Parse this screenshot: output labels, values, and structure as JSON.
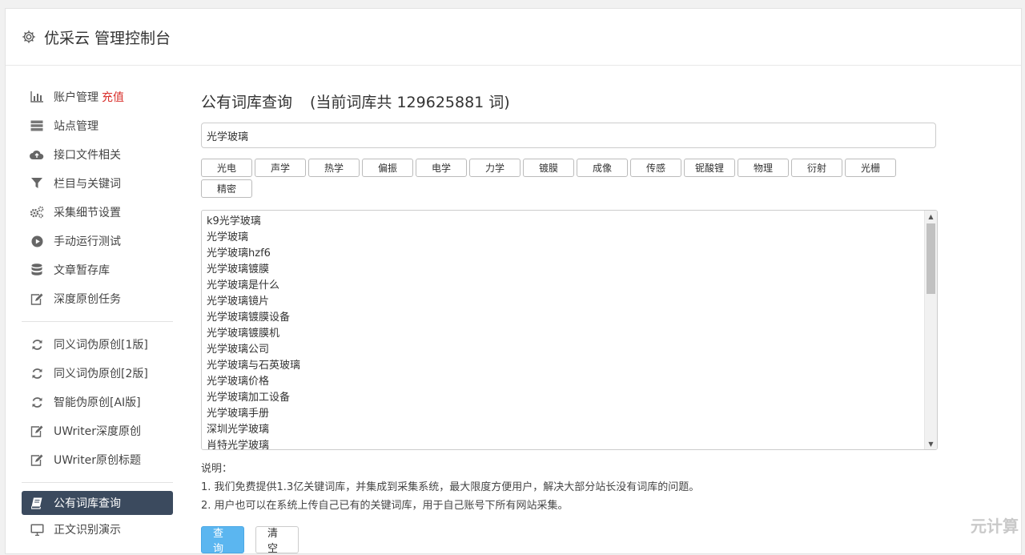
{
  "app": {
    "title": "优采云 管理控制台"
  },
  "sidebar": {
    "items": [
      {
        "label": "账户管理",
        "badge": "充值",
        "icon": "bar-chart-icon"
      },
      {
        "label": "站点管理",
        "icon": "server-icon"
      },
      {
        "label": "接口文件相关",
        "icon": "cloud-upload-icon"
      },
      {
        "label": "栏目与关键词",
        "icon": "filter-icon"
      },
      {
        "label": "采集细节设置",
        "icon": "gears-icon"
      },
      {
        "label": "手动运行测试",
        "icon": "play-icon"
      },
      {
        "label": "文章暂存库",
        "icon": "database-icon"
      },
      {
        "label": "深度原创任务",
        "icon": "edit-icon"
      },
      {
        "label": "同义词伪原创[1版]",
        "icon": "refresh-icon"
      },
      {
        "label": "同义词伪原创[2版]",
        "icon": "refresh-icon"
      },
      {
        "label": "智能伪原创[AI版]",
        "icon": "refresh-icon"
      },
      {
        "label": "UWriter深度原创",
        "icon": "edit-icon"
      },
      {
        "label": "UWriter原创标题",
        "icon": "edit-icon"
      },
      {
        "label": "公有词库查询",
        "icon": "book-icon",
        "active": true
      },
      {
        "label": "正文识别演示",
        "icon": "monitor-icon"
      }
    ]
  },
  "main": {
    "heading": "公有词库查询",
    "count_text": "(当前词库共 129625881 词)",
    "search_value": "光学玻璃",
    "chips": [
      "光电",
      "声学",
      "热学",
      "偏振",
      "电学",
      "力学",
      "镀膜",
      "成像",
      "传感",
      "铌酸锂",
      "物理",
      "衍射",
      "光栅",
      "精密"
    ],
    "results": [
      "k9光学玻璃",
      "光学玻璃",
      "光学玻璃hzf6",
      "光学玻璃镀膜",
      "光学玻璃是什么",
      "光学玻璃镜片",
      "光学玻璃镀膜设备",
      "光学玻璃镀膜机",
      "光学玻璃公司",
      "光学玻璃与石英玻璃",
      "光学玻璃价格",
      "光学玻璃加工设备",
      "光学玻璃手册",
      "深圳光学玻璃",
      "肖特光学玻璃"
    ],
    "notes_title": "说明：",
    "notes": [
      "1. 我们免费提供1.3亿关键词库，并集成到采集系统，最大限度方便用户，解决大部分站长没有词库的问题。",
      "2. 用户也可以在系统上传自己已有的关键词库，用于自己账号下所有网站采集。"
    ],
    "query_label": "查询",
    "clear_label": "清空"
  },
  "watermark": "元计算",
  "colors": {
    "accent": "#5bb6f0",
    "sidebar_active": "#3b4a5e",
    "recharge": "#d9302c"
  }
}
